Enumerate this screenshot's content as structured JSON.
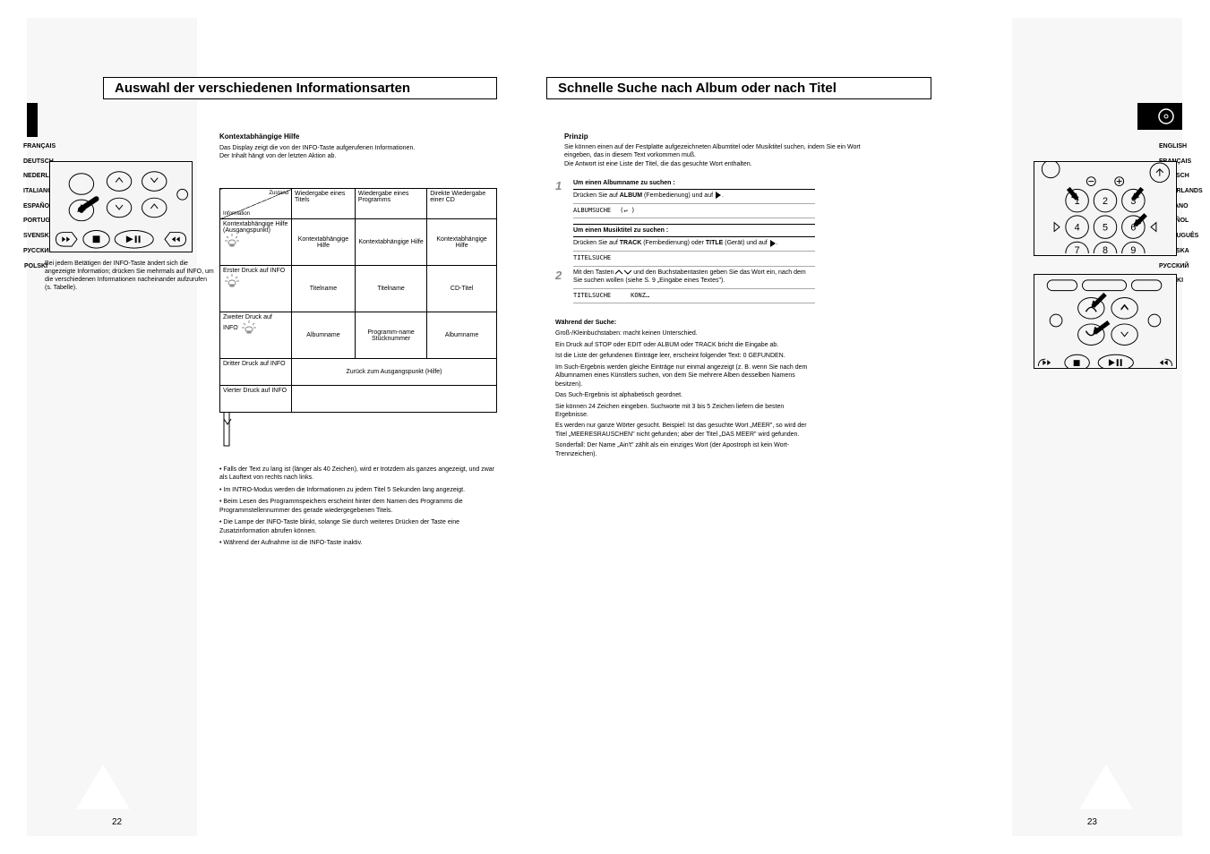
{
  "pageLeft": {
    "number": "22",
    "title": "Auswahl der verschiedenen Informationsarten",
    "langs": [
      "FRANÇAIS",
      "DEUTSCH",
      "NEDERLANDS",
      "ITALIANO",
      "ESPAÑOL",
      "PORTUGUÊS",
      "SVENSKA",
      "РУССКИЙ",
      "POLSKI"
    ],
    "help_heading": "Kontextabhängige Hilfe",
    "help_p1": "Das Display zeigt die von der INFO-Taste aufgerufenen Informationen.",
    "help_p2": "Der Inhalt hängt von der letzten Aktion ab.",
    "intro": "Bei jedem Betätigen der INFO-Taste ändert sich die angezeigte Information; drücken Sie mehrmals auf INFO, um die verschiedenen Informationen nacheinander aufzurufen (s. Tabelle).",
    "table": {
      "hdr_tl": "Zustand",
      "hdr_bl": "Information",
      "cols": [
        "Wiedergabe eines Titels",
        "Wiedergabe eines Programms",
        "Direkte Wiedergabe einer CD"
      ],
      "rows": [
        {
          "label": "Kontextabhängige Hilfe (Ausgangspunkt)",
          "lamp": true,
          "c1": "Kontextabhängige Hilfe",
          "c2": "Kontextabhängige Hilfe",
          "c3": "Kontextabhängige Hilfe"
        },
        {
          "label": "Erster Druck auf INFO",
          "lamp": true,
          "c1": "Titelname",
          "c2": "Titelname",
          "c3": "CD-Titel"
        },
        {
          "label": "Zweiter Druck auf INFO",
          "lamp": true,
          "c1": "Albumname",
          "c2": "Programm-name Stücknummer",
          "c3": "Albumname"
        },
        {
          "label": "Dritter Druck auf INFO",
          "c1": "Zurück zum Ausgangspunkt (Hilfe)",
          "span": 3
        },
        {
          "label": "Vierter Druck auf INFO",
          "c1": "",
          "span": 3
        }
      ]
    },
    "notes": [
      "Falls der Text zu lang ist (länger als 40 Zeichen), wird er trotzdem als ganzes angezeigt, und zwar als Lauftext von rechts nach links.",
      "Im INTRO-Modus werden die Informationen zu jedem Titel 5 Sekunden lang angezeigt.",
      "Beim Lesen des Programmspeichers erscheint hinter dem Namen des Programms die Programmstellennummer des gerade wiedergegebenen Titels.",
      "Die Lampe der INFO-Taste blinkt, solange Sie durch weiteres Drücken der Taste eine Zusatzinformation abrufen können.",
      "Während der Aufnahme ist die INFO-Taste inaktiv."
    ]
  },
  "pageRight": {
    "number": "23",
    "title": "Schnelle Suche nach Album oder nach Titel",
    "langs": [
      "ENGLISH",
      "FRANÇAIS",
      "DEUTSCH",
      "NEDERLANDS",
      "ITALIANO",
      "ESPAÑOL",
      "PORTUGUÊS",
      "SVENSKA",
      "РУССКИЙ",
      "POLSKI"
    ],
    "intro_heading": "Prinzip",
    "intro_p1": "Sie können einen auf der Festplatte aufgezeichneten Albumtitel oder Musiktitel suchen, indem Sie ein Wort eingeben, das in diesem Text vorkommen muß.",
    "intro_p2": "Die Antwort ist eine Liste der Titel, die das gesuchte Wort enthalten.",
    "step1": {
      "num": "1",
      "heading": "Um einen Albumname zu suchen :",
      "line1": "Drücken Sie auf ALBUM (Fernbedienung) und auf É.",
      "display_tag": "ALBUMSUCHE",
      "display_args": "(↵  )",
      "heading2": "Um einen Musiktitel zu suchen :",
      "line2": "Drücken Sie auf TRACK (Fernbedienung) oder TITLE (Gerät) und auf É.",
      "display_tag2": "TITELSUCHE"
    },
    "step2": {
      "num": "2",
      "heading": "Mit den Tasten ∧ ∨  und den Buchstabentasten geben Sie das Wort ein, nach dem Sie suchen wollen (siehe S. 9 „Eingabe eines Textes\").",
      "display_tag": "TITELSUCHE",
      "display_val": "KONZ…"
    },
    "notes_heading": "Während der Suche:",
    "notes": [
      "Groß-/Kleinbuchstaben: macht keinen Unterschied.",
      "Ein Druck auf STOP oder EDIT oder ALBUM oder TRACK bricht die Eingabe ab.",
      "Ist die Liste der gefundenen Einträge leer, erscheint folgender Text: 0 GEFUNDEN.",
      "Im Such-Ergebnis werden gleiche Einträge nur einmal angezeigt (z. B. wenn Sie nach dem Albumnamen eines Künstlers suchen, von dem Sie mehrere Alben desselben Namens besitzen).",
      "Das Such-Ergebnis ist alphabetisch geordnet.",
      "Sie können 24 Zeichen eingeben. Suchworte mit 3 bis 5 Zeichen liefern die besten Ergebnisse.",
      "Es werden nur ganze Wörter gesucht. Beispiel: Ist das gesuchte Wort „MEER\", so wird der Titel „MEERESRAUSCHEN\" nicht gefunden; aber der Titel „DAS MEER\" wird gefunden.",
      "Sonderfall: Der Name „Ain't\" zählt als ein einziges Wort (der Apostroph ist kein Wort-Trennzeichen)."
    ]
  }
}
